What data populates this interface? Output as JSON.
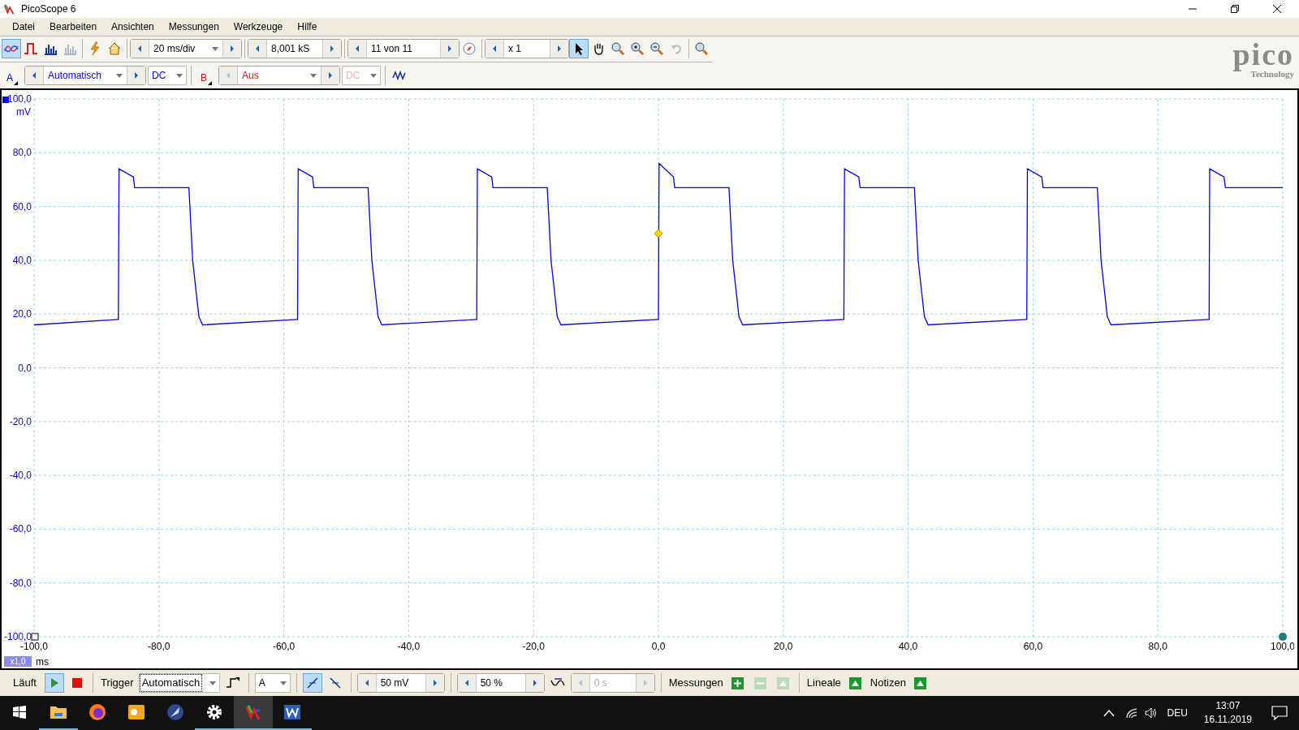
{
  "window": {
    "title": "PicoScope 6"
  },
  "menu": [
    "Datei",
    "Bearbeiten",
    "Ansichten",
    "Messungen",
    "Werkzeuge",
    "Hilfe"
  ],
  "toolbar": {
    "modes": [
      {
        "selected": true
      },
      {
        "selected": false
      },
      {
        "selected": false
      },
      {
        "selected": false
      }
    ],
    "timebase": "20 ms/div",
    "samples": "8,001 kS",
    "buffer": "11 von 11",
    "zoom": "x 1",
    "tools": [
      {
        "selected": true
      },
      {
        "selected": false
      },
      {
        "selected": false
      },
      {
        "selected": false
      },
      {
        "selected": false
      },
      {
        "selected": false
      }
    ]
  },
  "logo": {
    "name": "pico",
    "tagline": "Technology"
  },
  "channels": [
    {
      "label": "A",
      "range": "Automatisch",
      "coupling": "DC",
      "color": "#0000ff",
      "disabled": false
    },
    {
      "label": "B",
      "range": "Aus",
      "coupling": "DC",
      "color": "#ff0000",
      "disabled": true
    }
  ],
  "chart": {
    "scale": "x1,0",
    "chart_data": {
      "type": "line",
      "grid": true,
      "xlabel": "ms",
      "ylabel": "mV",
      "xlim": [
        -100,
        100
      ],
      "ylim": [
        -100,
        100
      ],
      "xticks": [
        {
          "value": -100,
          "label": "-100,0"
        },
        {
          "value": -80,
          "label": "-80,0"
        },
        {
          "value": -60,
          "label": "-60,0"
        },
        {
          "value": -40,
          "label": "-40,0"
        },
        {
          "value": -20,
          "label": "-20,0"
        },
        {
          "value": 0,
          "label": "0,0"
        },
        {
          "value": 20,
          "label": "20,0"
        },
        {
          "value": 40,
          "label": "40,0"
        },
        {
          "value": 60,
          "label": "60,0"
        },
        {
          "value": 80,
          "label": "80,0"
        },
        {
          "value": 100,
          "label": "100,0"
        }
      ],
      "yticks": [
        {
          "value": 100,
          "label": "100,0"
        },
        {
          "value": 80,
          "label": "80,0"
        },
        {
          "value": 60,
          "label": "60,0"
        },
        {
          "value": 40,
          "label": "40,0"
        },
        {
          "value": 20,
          "label": "20,0"
        },
        {
          "value": 0,
          "label": "0,0"
        },
        {
          "value": -20,
          "label": "-20,0"
        },
        {
          "value": -40,
          "label": "-40,0"
        },
        {
          "value": -60,
          "label": "-60,0"
        },
        {
          "value": -80,
          "label": "-80,0"
        },
        {
          "value": -100,
          "label": "-100,0"
        }
      ],
      "x": [
        -100,
        -86.6,
        -86.5,
        -86.4,
        -84.1,
        -83.9,
        -75.2,
        -74.6,
        -73.6,
        -73.0,
        -57.9,
        -57.8,
        -57.7,
        -55.4,
        -55.2,
        -46.5,
        -45.9,
        -44.9,
        -44.3,
        -29.2,
        -29.1,
        -29.0,
        -26.7,
        -26.5,
        -17.8,
        -17.2,
        -16.2,
        -15.6,
        -0.1,
        0,
        0.1,
        2.4,
        2.6,
        11.3,
        11.9,
        12.9,
        13.5,
        29.6,
        29.7,
        29.8,
        32.1,
        32.3,
        41.0,
        41.6,
        42.6,
        43.2,
        58.9,
        59.0,
        59.1,
        61.4,
        61.6,
        70.3,
        70.9,
        71.9,
        72.5,
        88.1,
        88.2,
        88.3,
        90.6,
        90.8,
        100
      ],
      "series": [
        {
          "color": "#0000ff",
          "values": [
            16,
            18,
            18,
            74,
            71,
            67,
            67,
            40,
            19,
            16,
            18,
            18,
            74,
            71,
            67,
            67,
            40,
            19,
            16,
            18,
            18,
            74,
            71,
            67,
            67,
            40,
            19,
            16,
            18,
            18,
            76,
            71,
            67,
            67,
            40,
            19,
            16,
            18,
            18,
            74,
            71,
            67,
            67,
            40,
            19,
            16,
            18,
            18,
            74,
            71,
            67,
            67,
            40,
            19,
            16,
            18,
            18,
            74,
            71,
            67,
            67
          ]
        }
      ]
    }
  },
  "bottom": {
    "status": "Läuft",
    "running": true,
    "trigger_label": "Trigger",
    "trigger_mode": "Automatisch",
    "source": "A",
    "edges": [
      {
        "selected": true
      },
      {
        "selected": false
      }
    ],
    "threshold": "50 mV",
    "pretrigger": "50 %",
    "delay": "0 s",
    "measurements": "Messungen",
    "rulers": "Lineale",
    "notes": "Notizen"
  },
  "taskbar": {
    "apps": [
      {
        "kind": "start",
        "open": false,
        "selected": false
      },
      {
        "kind": "folder",
        "open": true,
        "selected": false
      },
      {
        "kind": "browser",
        "open": false,
        "selected": false
      },
      {
        "kind": "mail",
        "open": false,
        "selected": false
      },
      {
        "kind": "feather",
        "open": false,
        "selected": false
      },
      {
        "kind": "gear",
        "open": true,
        "selected": false
      },
      {
        "kind": "scope",
        "open": true,
        "selected": true
      },
      {
        "kind": "word",
        "open": true,
        "selected": false
      }
    ],
    "language": "DEU",
    "time": "13:07",
    "date": "16.11.2019"
  }
}
